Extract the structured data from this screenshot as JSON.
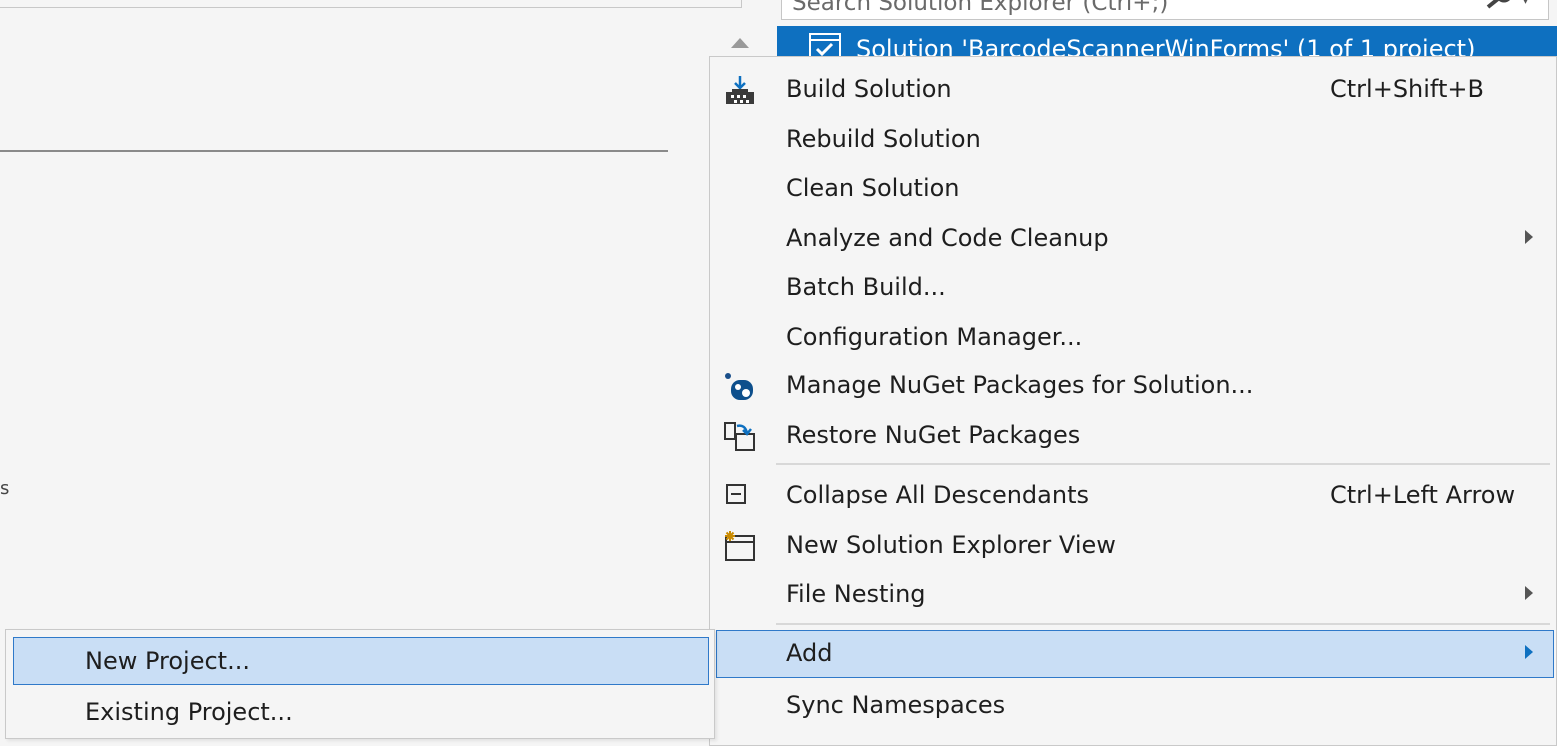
{
  "solution_explorer": {
    "search_placeholder": "Search Solution Explorer (Ctrl+;)",
    "solution_label": "Solution 'BarcodeScannerWinForms' (1 of 1 project)"
  },
  "left_panel": {
    "partial_text": "s"
  },
  "context_menu": {
    "items": [
      {
        "label": "Build Solution",
        "shortcut": "Ctrl+Shift+B",
        "icon": "build-icon"
      },
      {
        "label": "Rebuild Solution"
      },
      {
        "label": "Clean Solution"
      },
      {
        "label": "Analyze and Code Cleanup",
        "submenu": true
      },
      {
        "label": "Batch Build..."
      },
      {
        "label": "Configuration Manager..."
      },
      {
        "label": "Manage NuGet Packages for Solution...",
        "icon": "nuget-icon"
      },
      {
        "label": "Restore NuGet Packages",
        "icon": "restore-icon"
      },
      {
        "label": "Collapse All Descendants",
        "shortcut": "Ctrl+Left Arrow",
        "icon": "collapse-icon"
      },
      {
        "label": "New Solution Explorer View",
        "icon": "new-view-icon"
      },
      {
        "label": "File Nesting",
        "submenu": true
      },
      {
        "label": "Add",
        "submenu": true,
        "highlighted": true
      },
      {
        "label": "Sync Namespaces"
      }
    ]
  },
  "add_submenu": {
    "items": [
      {
        "label": "New Project...",
        "highlighted": true
      },
      {
        "label": "Existing Project..."
      }
    ]
  },
  "colors": {
    "selection_blue": "#0e70c0",
    "highlight_fill": "#c9def5",
    "highlight_border": "#2f79c9",
    "background": "#f5f5f5"
  }
}
